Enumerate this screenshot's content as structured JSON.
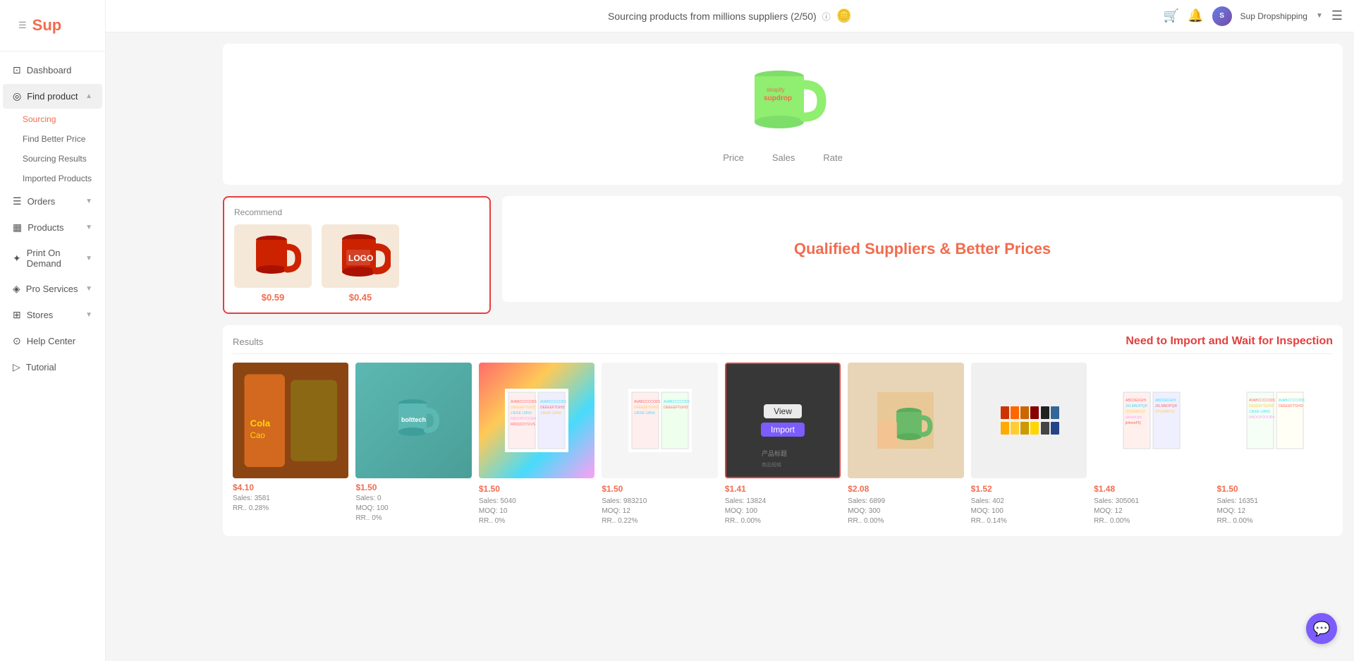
{
  "app": {
    "logo": "Sup",
    "header_title": "Sourcing products from millions suppliers (2/50)",
    "user_name": "Sup Dropshipping",
    "user_initials": "Sup"
  },
  "sidebar": {
    "items": [
      {
        "id": "dashboard",
        "label": "Dashboard",
        "icon": "⊡",
        "has_children": false
      },
      {
        "id": "find-product",
        "label": "Find product",
        "icon": "◎",
        "has_children": true,
        "expanded": true
      },
      {
        "id": "sourcing",
        "label": "Sourcing",
        "is_sub": true,
        "active": true
      },
      {
        "id": "find-better-price",
        "label": "Find Better Price",
        "is_sub": true
      },
      {
        "id": "sourcing-results",
        "label": "Sourcing Results",
        "is_sub": true
      },
      {
        "id": "imported-products",
        "label": "Imported Products",
        "is_sub": true
      },
      {
        "id": "orders",
        "label": "Orders",
        "icon": "☰",
        "has_children": true
      },
      {
        "id": "products",
        "label": "Products",
        "icon": "▦",
        "has_children": true
      },
      {
        "id": "print-on-demand",
        "label": "Print On Demand",
        "icon": "✦",
        "has_children": true
      },
      {
        "id": "pro-services",
        "label": "Pro Services",
        "icon": "◈",
        "has_children": true
      },
      {
        "id": "stores",
        "label": "Stores",
        "icon": "⊞",
        "has_children": true
      },
      {
        "id": "help-center",
        "label": "Help Center",
        "icon": "⊙"
      },
      {
        "id": "tutorial",
        "label": "Tutorial",
        "icon": "▷"
      }
    ]
  },
  "hero": {
    "tabs": [
      "Price",
      "Sales",
      "Rate"
    ]
  },
  "recommend": {
    "label": "Recommend",
    "products": [
      {
        "price": "$0.59"
      },
      {
        "price": "$0.45"
      }
    ]
  },
  "qualified": {
    "text": "Qualified Suppliers & Better Prices"
  },
  "results_section": {
    "label": "Results",
    "need_import_text": "Need to Import and Wait for Inspection",
    "items": [
      {
        "price": "$4.10",
        "sales": "Sales: 3581",
        "rr": "RR.. 0.28%"
      },
      {
        "price": "$1.50",
        "sales": "Sales: 0",
        "moq": "MOQ: 100",
        "rr": "RR.. 0%"
      },
      {
        "price": "$1.50",
        "sales": "Sales: 5040",
        "moq": "MOQ: 10",
        "rr": "RR.. 0%"
      },
      {
        "price": "$1.50",
        "sales": "Sales: 983210",
        "moq": "MOQ: 12",
        "rr": "RR.. 0.22%"
      },
      {
        "price": "$1.41",
        "sales": "Sales: 13824",
        "moq": "MOQ: 100",
        "rr": "RR.. 0.00%",
        "highlighted": true
      },
      {
        "price": "$2.08",
        "sales": "Sales: 6899",
        "moq": "MOQ: 300",
        "rr": "RR.. 0.00%"
      },
      {
        "price": "$1.52",
        "sales": "Sales: 402",
        "moq": "MOQ: 100",
        "rr": "RR.. 0.14%"
      },
      {
        "price": "$1.48",
        "sales": "Sales: 305061",
        "moq": "MOQ: 12",
        "rr": "RR.. 0.00%"
      },
      {
        "price": "$1.50",
        "sales": "Sales: 16351",
        "moq": "MOQ: 12",
        "rr": "RR.. 0.00%"
      }
    ]
  },
  "chat_btn": "💬"
}
